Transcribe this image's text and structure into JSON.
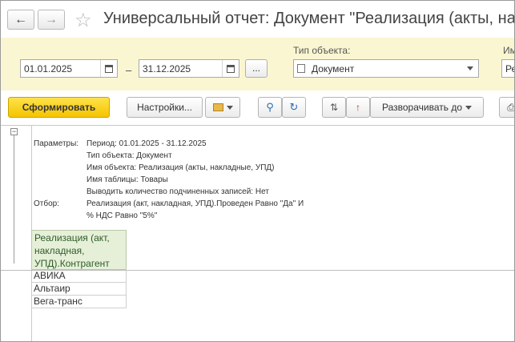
{
  "header": {
    "back_icon": "arrow-left",
    "forward_icon": "arrow-right",
    "favorite_icon": "star",
    "title": "Универсальный отчет: Документ \"Реализация (акты, накл..."
  },
  "params": {
    "date_from": "01.01.2025",
    "date_separator": "–",
    "date_to": "31.12.2025",
    "period_button": "...",
    "object_type_label": "Тип объекта:",
    "object_type_value": "Документ",
    "next_label_partial": "Им",
    "next_value_partial": "Ре"
  },
  "toolbar": {
    "generate": "Сформировать",
    "settings": "Настройки...",
    "expand": "Разворачивать до"
  },
  "report": {
    "params_label": "Параметры:",
    "param_lines": [
      "Период: 01.01.2025 - 31.12.2025",
      "Тип объекта: Документ",
      "Имя объекта: Реализация (акты, накладные, УПД)",
      "Имя таблицы: Товары",
      "Выводить количество подчиненных записей: Нет"
    ],
    "filter_label": "Отбор:",
    "filter_lines": [
      "Реализация (акт, накладная, УПД).Проведен Равно \"Да\" И",
      "% НДС Равно \"5%\""
    ],
    "column_header": "Реализация (акт, накладная, УПД).Контрагент",
    "rows": [
      "АВИКА",
      "Альтаир",
      "Вега-транс"
    ]
  },
  "colors": {
    "accent_yellow": "#f4c400",
    "param_band": "#faf6d2",
    "header_cell_bg": "#e6f0d8"
  }
}
